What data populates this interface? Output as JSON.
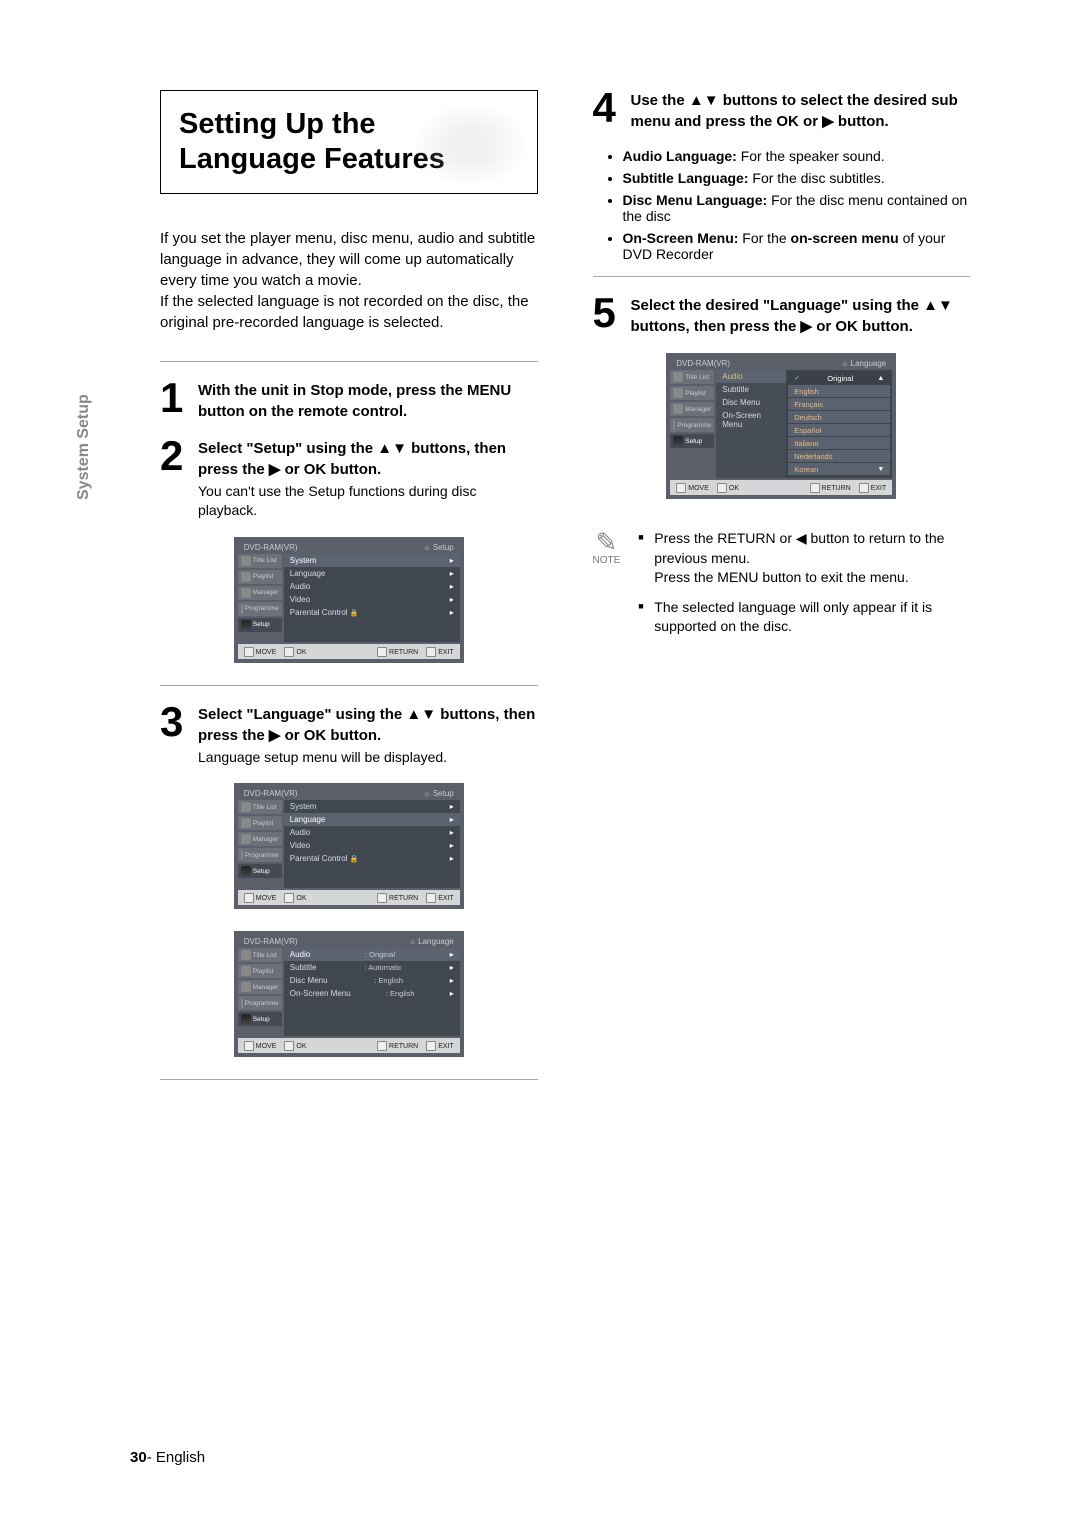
{
  "side_tab": "System Setup",
  "title": "Setting Up the Language Features",
  "intro": "If you set the player menu, disc menu, audio and subtitle language in advance, they will come up automatically every time you watch a movie.\nIf the selected language is not recorded on the disc, the original pre-recorded language is selected.",
  "steps": {
    "s1": {
      "num": "1",
      "heading": "With the unit in Stop mode, press the MENU button on the remote control."
    },
    "s2": {
      "num": "2",
      "heading": "Select \"Setup\" using the ▲▼ buttons, then press the ▶ or OK button.",
      "sub": "You can't use the Setup functions during disc playback."
    },
    "s3": {
      "num": "3",
      "heading": "Select \"Language\" using the ▲▼ buttons, then press the ▶ or OK button.",
      "sub": "Language setup menu will be displayed."
    },
    "s4": {
      "num": "4",
      "heading": "Use the ▲▼ buttons to select the desired sub menu and press the OK or ▶ button."
    },
    "s5": {
      "num": "5",
      "heading": "Select the desired \"Language\" using the ▲▼ buttons, then press the ▶ or OK button."
    }
  },
  "submenus": [
    {
      "label": "Audio Language:",
      "desc": " For the speaker sound."
    },
    {
      "label": "Subtitle Language:",
      "desc": " For the disc subtitles."
    },
    {
      "label": "Disc Menu Language:",
      "desc": " For the disc menu contained on the disc"
    },
    {
      "label": "On-Screen Menu:",
      "desc_pre": " For the ",
      "desc_bold": "on-screen menu",
      "desc_post": " of your DVD Recorder"
    }
  ],
  "osd": {
    "breadcrumb": "DVD-RAM(VR)",
    "context_setup": "Setup",
    "context_lang": "Language",
    "side_items": [
      "Title List",
      "Playlist",
      "Manager",
      "Programme",
      "Setup"
    ],
    "main_setup": [
      "System",
      "Language",
      "Audio",
      "Video",
      "Parental Control"
    ],
    "lang_rows": [
      {
        "label": "Audio",
        "val": ": Original"
      },
      {
        "label": "Subtitle",
        "val": ": Automatic"
      },
      {
        "label": "Disc Menu",
        "val": ": English"
      },
      {
        "label": "On-Screen Menu",
        "val": ": English"
      }
    ],
    "lang_sublist": [
      "Audio",
      "Subtitle",
      "Disc Menu",
      "On-Screen Menu"
    ],
    "lang_options": [
      "Original",
      "English",
      "Français",
      "Deutsch",
      "Español",
      "Italiano",
      "Nederlands",
      "Korean"
    ],
    "footer": {
      "move": "MOVE",
      "ok": "OK",
      "return": "RETURN",
      "exit": "EXIT"
    }
  },
  "notes": {
    "label": "NOTE",
    "items": [
      "Press the RETURN or ◀ button to return to the previous menu.\nPress the MENU button to exit the menu.",
      "The selected language will only appear if it is supported on the disc."
    ]
  },
  "footer": {
    "page": "30",
    "sep": "- ",
    "lang": "English"
  }
}
